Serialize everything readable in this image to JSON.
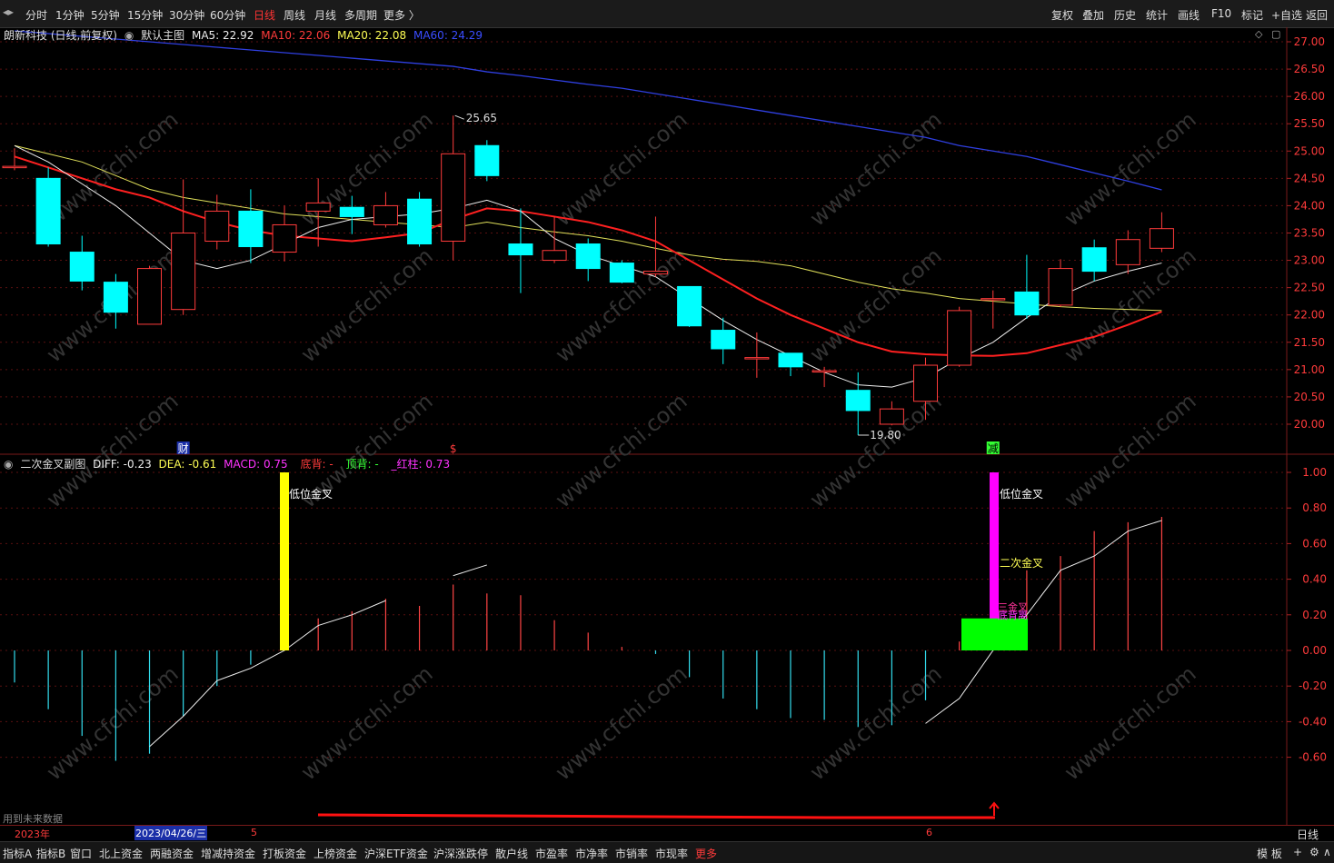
{
  "toolbar": {
    "periods": [
      "分时",
      "1分钟",
      "5分钟",
      "15分钟",
      "30分钟",
      "60分钟",
      "日线",
      "周线",
      "月线",
      "多周期",
      "更多 〉"
    ],
    "active_period": "日线",
    "right_buttons": [
      "复权",
      "叠加",
      "历史",
      "统计",
      "画线",
      "F10",
      "标记",
      "+自选",
      "返回"
    ]
  },
  "main_panel": {
    "stock": "朗新科技 (日线,前复权)",
    "template": "默认主图",
    "ma5": "MA5: 22.92",
    "ma10": "MA10: 22.06",
    "ma20": "MA20: 22.08",
    "ma60": "MA60: 24.29",
    "high_label": "25.65",
    "low_label": "19.80",
    "event_labels": [
      "财",
      "$",
      "减"
    ],
    "price_ticks": [
      "27.00",
      "26.50",
      "26.00",
      "25.50",
      "25.00",
      "24.50",
      "24.00",
      "23.50",
      "23.00",
      "22.50",
      "22.00",
      "21.50",
      "21.00",
      "20.50",
      "20.00"
    ]
  },
  "sub_panel": {
    "name": "二次金叉副图",
    "diff": "DIFF: -0.23",
    "dea": "DEA: -0.61",
    "macd": "MACD: 0.75",
    "dibei": "底背: -",
    "dingbei": "顶背: -",
    "hongzhu": "_红柱: 0.73",
    "signal_low1": "低位金叉",
    "signal_low2": "低位金叉",
    "signal_second": "二次金叉",
    "signal_small1": "三金叉",
    "signal_small2": "底背离",
    "future_note": "用到未来数据",
    "macd_ticks": [
      "1.00",
      "0.80",
      "0.60",
      "0.40",
      "0.20",
      "0.00",
      "-0.20",
      "-0.40",
      "-0.60"
    ]
  },
  "date_axis": {
    "year": "2023年",
    "cursor_date": "2023/04/26/三",
    "m5": "5",
    "m6": "6",
    "period": "日线"
  },
  "bottom_tabs": [
    "指标A",
    "指标B",
    "窗口",
    "北上资金",
    "两融资金",
    "增减持资金",
    "打板资金",
    "上榜资金",
    "沪深ETF资金",
    "沪深涨跌停",
    "散户线",
    "市盈率",
    "市净率",
    "市销率",
    "市现率",
    "更多"
  ],
  "bottom_right": [
    "模 板",
    "+",
    "⚙",
    "∧"
  ],
  "watermark": "www.cfchi.com",
  "chart_data": {
    "type": "candlestick",
    "candles": [
      {
        "o": 24.7,
        "h": 25.05,
        "l": 24.65,
        "c": 24.72
      },
      {
        "o": 24.5,
        "h": 24.7,
        "l": 23.25,
        "c": 23.3
      },
      {
        "o": 23.15,
        "h": 23.45,
        "l": 22.45,
        "c": 22.62
      },
      {
        "o": 22.6,
        "h": 22.75,
        "l": 21.75,
        "c": 22.05
      },
      {
        "o": 21.83,
        "h": 22.9,
        "l": 21.83,
        "c": 22.85
      },
      {
        "o": 22.1,
        "h": 24.48,
        "l": 22.0,
        "c": 23.5
      },
      {
        "o": 23.35,
        "h": 24.2,
        "l": 23.2,
        "c": 23.9
      },
      {
        "o": 23.9,
        "h": 24.3,
        "l": 22.95,
        "c": 23.25
      },
      {
        "o": 23.15,
        "h": 24.0,
        "l": 22.98,
        "c": 23.65
      },
      {
        "o": 23.9,
        "h": 24.5,
        "l": 23.25,
        "c": 24.05
      },
      {
        "o": 23.97,
        "h": 24.18,
        "l": 23.48,
        "c": 23.8
      },
      {
        "o": 23.65,
        "h": 24.25,
        "l": 23.6,
        "c": 24.0
      },
      {
        "o": 24.12,
        "h": 24.25,
        "l": 23.25,
        "c": 23.3
      },
      {
        "o": 23.35,
        "h": 25.65,
        "l": 23.0,
        "c": 24.95
      },
      {
        "o": 25.1,
        "h": 25.2,
        "l": 24.45,
        "c": 24.55
      },
      {
        "o": 23.3,
        "h": 23.95,
        "l": 22.4,
        "c": 23.1
      },
      {
        "o": 23.0,
        "h": 23.8,
        "l": 22.95,
        "c": 23.18
      },
      {
        "o": 23.3,
        "h": 23.4,
        "l": 22.62,
        "c": 22.85
      },
      {
        "o": 22.95,
        "h": 23.0,
        "l": 22.58,
        "c": 22.6
      },
      {
        "o": 22.75,
        "h": 23.8,
        "l": 22.7,
        "c": 22.8
      },
      {
        "o": 22.52,
        "h": 22.52,
        "l": 21.78,
        "c": 21.8
      },
      {
        "o": 21.72,
        "h": 21.95,
        "l": 21.1,
        "c": 21.38
      },
      {
        "o": 21.22,
        "h": 21.68,
        "l": 20.85,
        "c": 21.22
      },
      {
        "o": 21.3,
        "h": 21.3,
        "l": 20.88,
        "c": 21.05
      },
      {
        "o": 20.98,
        "h": 21.05,
        "l": 20.68,
        "c": 20.98
      },
      {
        "o": 20.62,
        "h": 20.95,
        "l": 19.8,
        "c": 20.25
      },
      {
        "o": 20.0,
        "h": 20.42,
        "l": 19.98,
        "c": 20.28
      },
      {
        "o": 20.42,
        "h": 21.22,
        "l": 20.08,
        "c": 21.08
      },
      {
        "o": 21.08,
        "h": 22.15,
        "l": 21.05,
        "c": 22.08
      },
      {
        "o": 22.3,
        "h": 22.45,
        "l": 21.75,
        "c": 22.3
      },
      {
        "o": 22.42,
        "h": 23.1,
        "l": 21.93,
        "c": 22.0
      },
      {
        "o": 22.18,
        "h": 23.02,
        "l": 22.15,
        "c": 22.85
      },
      {
        "o": 23.23,
        "h": 23.38,
        "l": 22.62,
        "c": 22.8
      },
      {
        "o": 22.92,
        "h": 23.55,
        "l": 22.75,
        "c": 23.38
      },
      {
        "o": 23.22,
        "h": 23.88,
        "l": 23.15,
        "c": 23.58
      }
    ],
    "ma5": [
      25.1,
      24.8,
      24.4,
      24.0,
      23.5,
      23.0,
      22.85,
      23.0,
      23.3,
      23.6,
      23.75,
      23.8,
      23.85,
      23.95,
      24.1,
      23.9,
      23.4,
      23.1,
      22.9,
      22.7,
      22.3,
      21.9,
      21.55,
      21.25,
      20.95,
      20.72,
      20.68,
      20.85,
      21.2,
      21.5,
      21.95,
      22.35,
      22.62,
      22.8,
      22.95
    ],
    "ma10": [
      24.9,
      24.7,
      24.5,
      24.3,
      24.15,
      23.9,
      23.7,
      23.55,
      23.45,
      23.4,
      23.35,
      23.42,
      23.5,
      23.75,
      23.95,
      23.9,
      23.8,
      23.7,
      23.55,
      23.35,
      23.0,
      22.65,
      22.3,
      22.0,
      21.75,
      21.5,
      21.33,
      21.28,
      21.26,
      21.25,
      21.3,
      21.45,
      21.6,
      21.82,
      22.06
    ],
    "ma20": [
      25.1,
      24.95,
      24.8,
      24.55,
      24.3,
      24.15,
      24.05,
      23.95,
      23.85,
      23.8,
      23.75,
      23.7,
      23.65,
      23.6,
      23.7,
      23.6,
      23.52,
      23.45,
      23.35,
      23.22,
      23.1,
      23.02,
      22.98,
      22.9,
      22.75,
      22.6,
      22.48,
      22.4,
      22.3,
      22.25,
      22.2,
      22.15,
      22.12,
      22.1,
      22.08
    ],
    "ma60": [
      27.2,
      27.15,
      27.1,
      27.05,
      27.0,
      26.95,
      26.9,
      26.85,
      26.8,
      26.75,
      26.7,
      26.65,
      26.6,
      26.55,
      26.45,
      26.38,
      26.3,
      26.22,
      26.15,
      26.05,
      25.95,
      25.85,
      25.75,
      25.65,
      25.55,
      25.45,
      25.35,
      25.25,
      25.1,
      25.0,
      24.9,
      24.75,
      24.6,
      24.45,
      24.29
    ],
    "macd_hist": [
      -0.18,
      -0.33,
      -0.48,
      -0.62,
      -0.58,
      -0.37,
      -0.2,
      -0.08,
      0.14,
      0.18,
      0.22,
      0.29,
      0.25,
      0.37,
      0.32,
      0.31,
      0.17,
      0.1,
      0.02,
      -0.02,
      -0.15,
      -0.27,
      -0.33,
      -0.38,
      -0.39,
      -0.43,
      -0.42,
      -0.28,
      0.05,
      0.2,
      0.45,
      0.53,
      0.67,
      0.72,
      0.75
    ],
    "diff": [
      null,
      null,
      null,
      null,
      -0.54,
      -0.37,
      -0.17,
      -0.1,
      0.0,
      0.14,
      0.2,
      0.28,
      null,
      0.42,
      0.48,
      null,
      null,
      null,
      null,
      null,
      null,
      null,
      null,
      null,
      null,
      null,
      null,
      -0.41,
      -0.27,
      0.0,
      0.2,
      0.45,
      0.53,
      0.67,
      0.73
    ],
    "macd_range": [
      -0.6,
      1.0
    ],
    "price_range": [
      19.5,
      27.2
    ]
  }
}
